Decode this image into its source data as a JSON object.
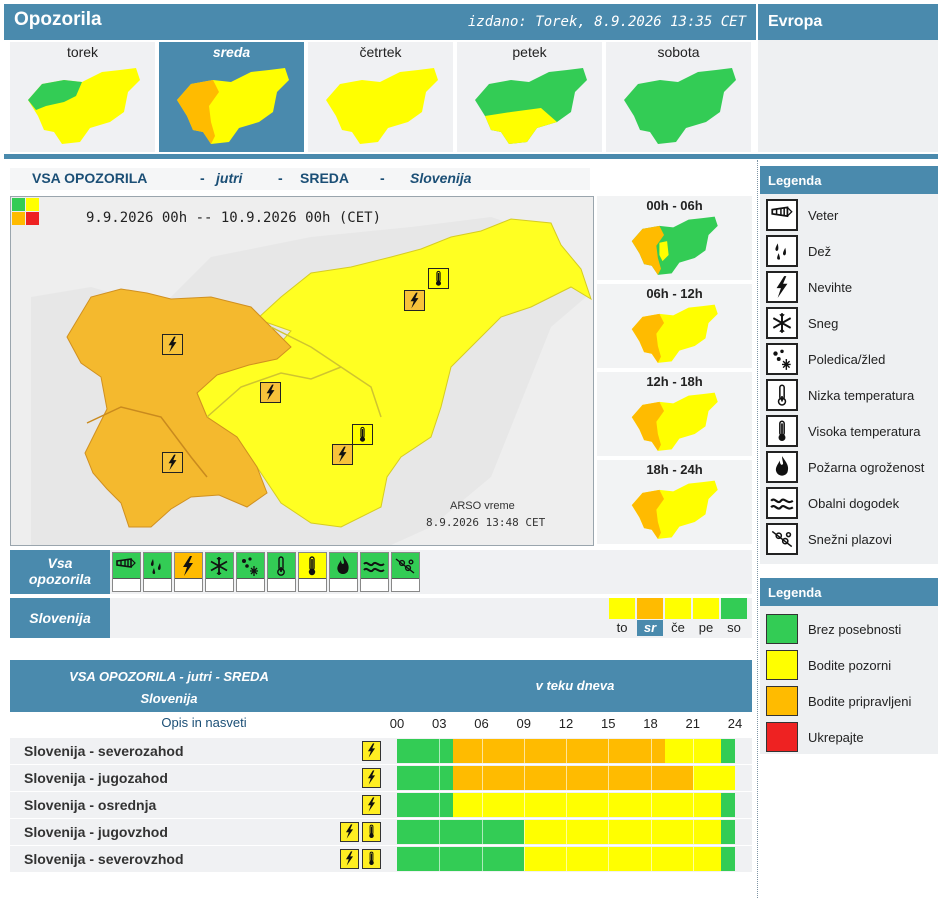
{
  "header": {
    "title": "Opozorila",
    "issued": "izdano: Torek, 8.9.2026 13:35 CET",
    "europe": "Evropa"
  },
  "days": [
    {
      "label": "torek",
      "active": false
    },
    {
      "label": "sreda",
      "active": true
    },
    {
      "label": "četrtek",
      "active": false
    },
    {
      "label": "petek",
      "active": false
    },
    {
      "label": "sobota",
      "active": false
    }
  ],
  "map": {
    "heading": {
      "a": "VSA OPOZORILA",
      "dash1": "-",
      "b": "jutri",
      "dash2": "-",
      "c": "SREDA",
      "dash3": "-",
      "d": "Slovenija"
    },
    "date_range": "9.9.2026 00h -- 10.9.2026 00h (CET)",
    "credit": "ARSO vreme",
    "credit_time": "8.9.2026 13:48 CET"
  },
  "slices": [
    "00h - 06h",
    "06h - 12h",
    "12h - 18h",
    "18h - 24h"
  ],
  "filters": {
    "all_label": [
      "Vsa",
      "opozorila"
    ],
    "icons": [
      {
        "name": "wind-icon",
        "level": "green"
      },
      {
        "name": "rain-icon",
        "level": "green"
      },
      {
        "name": "thunderstorm-icon",
        "level": "orange"
      },
      {
        "name": "snow-icon",
        "level": "green"
      },
      {
        "name": "black-ice-icon",
        "level": "green"
      },
      {
        "name": "low-temperature-icon",
        "level": "green"
      },
      {
        "name": "high-temperature-icon",
        "level": "yellow"
      },
      {
        "name": "fire-danger-icon",
        "level": "green"
      },
      {
        "name": "coastal-event-icon",
        "level": "green"
      },
      {
        "name": "avalanche-icon",
        "level": "green"
      }
    ],
    "region_label": "Slovenija",
    "day_abbr": [
      {
        "label": "to",
        "level": "yellow",
        "active": false
      },
      {
        "label": "sr",
        "level": "orange",
        "active": true
      },
      {
        "label": "če",
        "level": "yellow",
        "active": false
      },
      {
        "label": "pe",
        "level": "yellow",
        "active": false
      },
      {
        "label": "so",
        "level": "green",
        "active": false
      }
    ]
  },
  "table": {
    "title1": "VSA OPOZORILA - jutri - SREDA",
    "title2": "Slovenija",
    "right_title": "v teku dneva",
    "opis": "Opis in nasveti",
    "hours": [
      "00",
      "03",
      "06",
      "09",
      "12",
      "15",
      "18",
      "21",
      "24"
    ],
    "rows": [
      {
        "name": "Slovenija - severozahod",
        "icons": [
          "thunderstorm-icon"
        ],
        "segments": [
          {
            "from": 0,
            "to": 4,
            "level": "green"
          },
          {
            "from": 4,
            "to": 19,
            "level": "orange"
          },
          {
            "from": 19,
            "to": 23,
            "level": "yellow"
          },
          {
            "from": 23,
            "to": 24,
            "level": "green"
          }
        ]
      },
      {
        "name": "Slovenija - jugozahod",
        "icons": [
          "thunderstorm-icon"
        ],
        "segments": [
          {
            "from": 0,
            "to": 4,
            "level": "green"
          },
          {
            "from": 4,
            "to": 21,
            "level": "orange"
          },
          {
            "from": 21,
            "to": 24,
            "level": "yellow"
          }
        ]
      },
      {
        "name": "Slovenija - osrednja",
        "icons": [
          "thunderstorm-icon"
        ],
        "segments": [
          {
            "from": 0,
            "to": 4,
            "level": "green"
          },
          {
            "from": 4,
            "to": 23,
            "level": "yellow"
          },
          {
            "from": 23,
            "to": 24,
            "level": "green"
          }
        ]
      },
      {
        "name": "Slovenija - jugovzhod",
        "icons": [
          "thunderstorm-icon",
          "high-temperature-icon"
        ],
        "segments": [
          {
            "from": 0,
            "to": 9,
            "level": "green"
          },
          {
            "from": 9,
            "to": 23,
            "level": "yellow"
          },
          {
            "from": 23,
            "to": 24,
            "level": "green"
          }
        ]
      },
      {
        "name": "Slovenija - severovzhod",
        "icons": [
          "thunderstorm-icon",
          "high-temperature-icon"
        ],
        "segments": [
          {
            "from": 0,
            "to": 9,
            "level": "green"
          },
          {
            "from": 9,
            "to": 23,
            "level": "yellow"
          },
          {
            "from": 23,
            "to": 24,
            "level": "green"
          }
        ]
      }
    ]
  },
  "legend1": {
    "title": "Legenda",
    "items": [
      {
        "label": "Veter",
        "icon": "wind-icon"
      },
      {
        "label": "Dež",
        "icon": "rain-icon"
      },
      {
        "label": "Nevihte",
        "icon": "thunderstorm-icon"
      },
      {
        "label": "Sneg",
        "icon": "snow-icon"
      },
      {
        "label": "Poledica/žled",
        "icon": "black-ice-icon"
      },
      {
        "label": "Nizka temperatura",
        "icon": "low-temperature-icon"
      },
      {
        "label": "Visoka temperatura",
        "icon": "high-temperature-icon"
      },
      {
        "label": "Požarna ogroženost",
        "icon": "fire-danger-icon"
      },
      {
        "label": "Obalni dogodek",
        "icon": "coastal-event-icon"
      },
      {
        "label": "Snežni plazovi",
        "icon": "avalanche-icon"
      }
    ]
  },
  "legend2": {
    "title": "Legenda",
    "items": [
      {
        "label": "Brez posebnosti",
        "color": "#33cc55"
      },
      {
        "label": "Bodite pozorni",
        "color": "#ffff00"
      },
      {
        "label": "Bodite pripravljeni",
        "color": "#ffbb00"
      },
      {
        "label": "Ukrepajte",
        "color": "#ee2222"
      }
    ]
  },
  "colors": {
    "green": "#33cc55",
    "yellow": "#ffff00",
    "orange": "#ffbb00",
    "red": "#ee2222",
    "accent": "#4a8aad"
  }
}
